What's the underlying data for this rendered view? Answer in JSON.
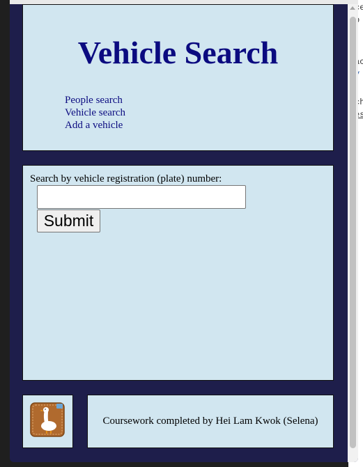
{
  "header": {
    "title": "Vehicle Search",
    "nav": [
      {
        "label": "People search"
      },
      {
        "label": "Vehicle search"
      },
      {
        "label": "Add a vehicle"
      }
    ]
  },
  "search": {
    "label": "Search by vehicle registration (plate) number:",
    "value": "",
    "submit_label": "Submit"
  },
  "footer": {
    "logo_icon": "goose-logo-icon",
    "text": "Coursework completed by Hei Lam Kwok (Selena)"
  },
  "background_fragments": [
    "ce",
    "p",
    "ac",
    "y",
    "ch",
    "es"
  ],
  "colors": {
    "page_bg": "#1e1e4b",
    "panel_bg": "#d1e6f0",
    "title": "#0b0b80"
  }
}
